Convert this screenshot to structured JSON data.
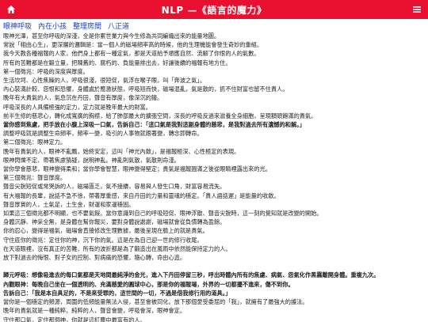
{
  "header": {
    "title": "NLP —《語言的魔力》",
    "home_icon": "home-icon",
    "menu_icon": "hamburger-menu-icon",
    "bg_color": "#e8102e"
  },
  "tabs": [
    {
      "label": "眼神呼吸"
    },
    {
      "label": "內在小孩"
    },
    {
      "label": "整理房間"
    },
    {
      "label": "八正道"
    }
  ],
  "lines": [
    {
      "text": "眼神光澤，甚至你呼吸的深淺，全是你累世業力與今生修為共同編織出來的能量地圖。",
      "bold": false
    },
    {
      "text": "常說「相由心生」，更深層的邏輯是：當一個人的磁場頻率高的時候，他的生理機能會發生奇妙的重組。",
      "bold": false
    },
    {
      "text": "我今天教各種福報的人家，他們身上都有一種定氣，那是天道給予順應自然、流解了你恨的人的氣數。",
      "bold": false
    },
    {
      "text": "所有的苦難都是在鍛立量，把陳舊的、腐朽的、負能量排出去，好讓後續的福報有地方住。",
      "bold": false
    },
    {
      "text": "第一個徵兆：呼吸的深度與厚度。",
      "bold": false
    },
    {
      "text": "生活坎坷、心性焦躁的人，呼吸很淺，很短促，氣浮在喉子眼，叫「奔波之氣」。",
      "bold": false
    },
    {
      "text": "內心裝滿計較、怨恨和恐懼，身體處於應激狀態，呼吸短而快，磁場混亂，氣是散的，抓不住財富也留不住貴人。",
      "bold": false
    },
    {
      "text": "晚年有大貴氣的人，氣息沉在丹田，聲音有厚度，像深沉的鐘。",
      "bold": false
    },
    {
      "text": "呼吸深長的人具備極強的定力，定力就是晚年最大的財富。",
      "bold": false
    },
    {
      "text": "前半生修的慈悲心，轉化成寬廣的胸襟，給了肺部最大的擴張空間，深長的呼吸反過來滋養全身細胞，呈現額頭飽滿的貴氣。",
      "bold": false
    },
    {
      "text": "當你感到焦慮，把手放在小腹上深吸一口氣，告訴自己：「這口氣是我對這副身體的慈悲，是我對過去所有遺憾的和解。」",
      "bold": true
    },
    {
      "text": "調整呼吸就是調整生命頻率，頻率一變，吸引的人事物就跟著變，轉念即轉命。",
      "bold": false
    },
    {
      "text": "第二個徵兆：眼神定力。",
      "bold": false
    },
    {
      "text": "晚年有貴氣的人，眼神不亂飄，始終安定，這叫「神光內斂」，是福報極深、心性極定的表現。",
      "bold": false
    },
    {
      "text": "眼神閃爍不定、帶著焦慮猜疑，說明神亂。神亂則氣散，氣散則命淺。",
      "bold": false
    },
    {
      "text": "當你學會慈悲，眼神變得柔和；當你學會智慧，眼神變得堅定；貴氣是福報圓滿之後從眼睛裡露出來的光。",
      "bold": false
    },
    {
      "text": "第三個徵兆：聲音厚度。",
      "bold": false
    },
    {
      "text": "聲音尖銳短促或常哭訴的人，磁場匱乏，氣不接續，容易與人發生口角，財富容易流失。",
      "bold": false
    },
    {
      "text": "有大福報的長輩，說話不急不徐，帶著厚重感，來自丹田的力量和靈魂的穩定。「貴人語話遲」是能量的收斂。",
      "bold": false
    },
    {
      "text": "聲音厚實的人，土氣足，土生金，財運和家運穩固。",
      "bold": false
    },
    {
      "text": "如果這三個徵兆都不明顯，也不要氣餒。當你意識到自己的呼吸短促、眼神浮散、聲音尖銳時，這一刻的覺知就是改變的開始。",
      "bold": false
    },
    {
      "text": "身體沉靜、神采全無，是身體在幫你報災，要對身體說謝謝，磁場就會從負債轉為盈餘。",
      "bold": false
    },
    {
      "text": "你的忍心，變得是福氣，磁場會直接修改生理數據，最後呈現在臉上的就是貴氣。",
      "bold": false
    },
    {
      "text": "守住底你的徵兆：定住你的神，沉下你的氣。這是在為自己迎一世的修行收尾。",
      "bold": false
    },
    {
      "text": "在天道眼裡，沒有真正的苦難，所有的波折都是為了鍛造出在風雨中依然能保持定力的人。",
      "bold": false
    },
    {
      "text": "放下對過去的悔恨、對子女的控制、對病痛的恐懼，隨心轉，命由心造。",
      "bold": false
    },
    {
      "text": "",
      "bold": false
    },
    {
      "text": "歸元呼吸：想像吸進去的每口氣都是天地間最純淨的金光，進入下丹田停留三秒，呼出時體內所有的焦慮、病氣、怨氣化作黑霧離開身體。重複九次。",
      "bold": true
    },
    {
      "text": "內觀眼神：每晚自己坐在一個透明的、充滿慈愛的圓球中心，那是你的福報場，外界的一切都擾不進來，傷不到你。",
      "bold": true
    },
    {
      "text": "告訴自己：「我是本自具足的，不是來受罪的，這世間的一切，不過是借我修行用的道具。」",
      "bold": true
    },
    {
      "text": "當你是一個穩定的頻源，周圍的低頻能量無法入侵，甚至會被同化。放下那個愛受委屈的「我」，就擁有了最強大的護法。",
      "bold": false
    },
    {
      "text": "晚年的貴氣就是一種純粹。純粹的人，聲音會變，呼吸會深，眼神會定。",
      "bold": false
    },
    {
      "text": "守住那口氣，定住那個神，你就是這紅塵中最富有的人。",
      "bold": false
    },
    {
      "text": "守正道，只問為，但做一件，與人為善，恰是自在修行的上工，才能見你本來的真意。不論外面世界多麼吵擾不安，這就是最好的修養了。",
      "bold": false
    }
  ]
}
